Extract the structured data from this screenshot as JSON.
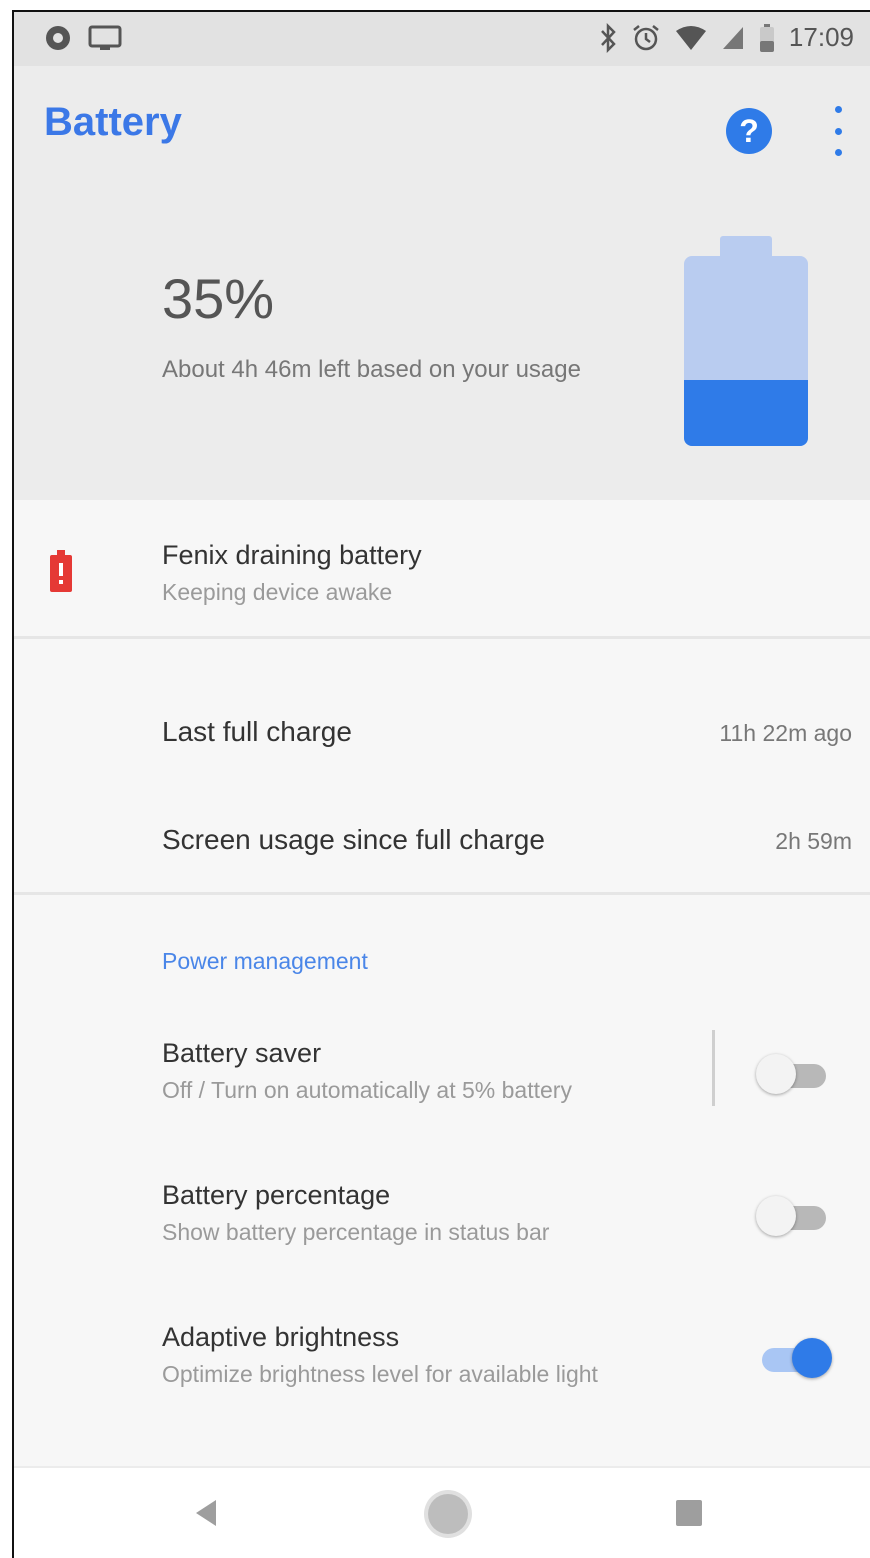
{
  "status_bar": {
    "time": "17:09",
    "icons": [
      "notification-circle-icon",
      "screen-cast-icon",
      "bluetooth-icon",
      "alarm-icon",
      "wifi-icon",
      "cell-signal-icon",
      "battery-status-icon"
    ]
  },
  "app_bar": {
    "title": "Battery",
    "help_label": "?",
    "more_icon": "more-vert-icon"
  },
  "battery": {
    "percent_text": "35%",
    "level": 0.35,
    "estimate": "About 4h 46m left based on your usage",
    "colors": {
      "fill": "#2f7be8",
      "empty": "#b9ccf0"
    }
  },
  "alert": {
    "title": "Fenix draining battery",
    "subtitle": "Keeping device awake",
    "icon": "battery-alert-icon",
    "color": "#e53935"
  },
  "usage": {
    "last_full_charge_label": "Last full charge",
    "last_full_charge_value": "11h 22m ago",
    "screen_usage_label": "Screen usage since full charge",
    "screen_usage_value": "2h 59m"
  },
  "power_management": {
    "header": "Power management",
    "items": [
      {
        "title": "Battery saver",
        "subtitle": "Off / Turn on automatically at 5% battery",
        "on": false
      },
      {
        "title": "Battery percentage",
        "subtitle": "Show battery percentage in status bar",
        "on": false
      },
      {
        "title": "Adaptive brightness",
        "subtitle": "Optimize brightness level for available light",
        "on": true
      }
    ]
  },
  "nav_bar": {
    "back_icon": "nav-back-icon",
    "home_icon": "nav-home-icon",
    "recent_icon": "nav-recents-icon"
  },
  "accent_color": "#3b78e7"
}
